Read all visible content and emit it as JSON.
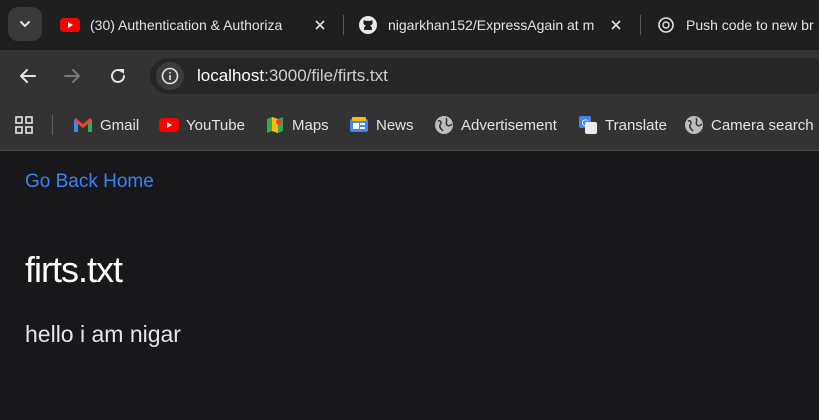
{
  "tabs": [
    {
      "title": "(30) Authentication & Authoriza",
      "icon": "youtube-icon"
    },
    {
      "title": "nigarkhan152/ExpressAgain at m",
      "icon": "github-icon"
    },
    {
      "title": "Push code to new br",
      "icon": "chatgpt-icon"
    }
  ],
  "address_bar": {
    "url_host": "localhost",
    "url_path": ":3000/file/firts.txt"
  },
  "bookmarks": [
    {
      "label": "Gmail",
      "icon": "gmail-icon"
    },
    {
      "label": "YouTube",
      "icon": "youtube-icon"
    },
    {
      "label": "Maps",
      "icon": "maps-icon"
    },
    {
      "label": "News",
      "icon": "news-icon"
    },
    {
      "label": "Advertisement",
      "icon": "globe-icon"
    },
    {
      "label": "Translate",
      "icon": "translate-icon"
    },
    {
      "label": "Camera search",
      "icon": "globe-icon"
    }
  ],
  "page": {
    "back_link": "Go Back Home",
    "title": "firts.txt",
    "content": "hello i am nigar"
  },
  "colors": {
    "link": "#3b82f6",
    "background": "#18181a",
    "youtube_red": "#ff0000"
  }
}
